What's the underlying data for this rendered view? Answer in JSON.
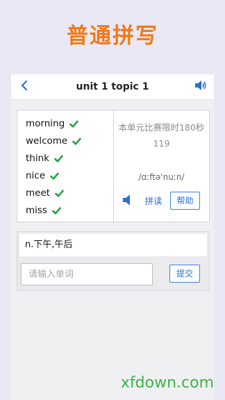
{
  "banner": {
    "title": "普通拼写"
  },
  "topbar": {
    "title": "unit 1 topic 1",
    "back_icon": "chevron-left-icon",
    "speaker_icon": "speaker-icon"
  },
  "word_list": {
    "items": [
      {
        "word": "morning",
        "status": "correct"
      },
      {
        "word": "welcome",
        "status": "correct"
      },
      {
        "word": "think",
        "status": "correct"
      },
      {
        "word": "nice",
        "status": "correct"
      },
      {
        "word": "meet",
        "status": "correct"
      },
      {
        "word": "miss",
        "status": "correct"
      }
    ]
  },
  "info": {
    "rule_text": "本单元比赛限时180秒",
    "timer": "119",
    "phonetic": "/ɑːftə'nuːn/",
    "spell_label": "拼读",
    "help_label": "帮助"
  },
  "answer": {
    "meaning": "n.下午,午后",
    "input_placeholder": "请输入单词",
    "input_value": "",
    "submit_label": "提交"
  },
  "watermark": {
    "text": "xfdown.com"
  },
  "colors": {
    "accent_orange": "#f27a1a",
    "link_blue": "#2b6fd6",
    "check_green": "#22a03c",
    "watermark_green": "#3bb34a",
    "background": "#e9e8f4"
  }
}
